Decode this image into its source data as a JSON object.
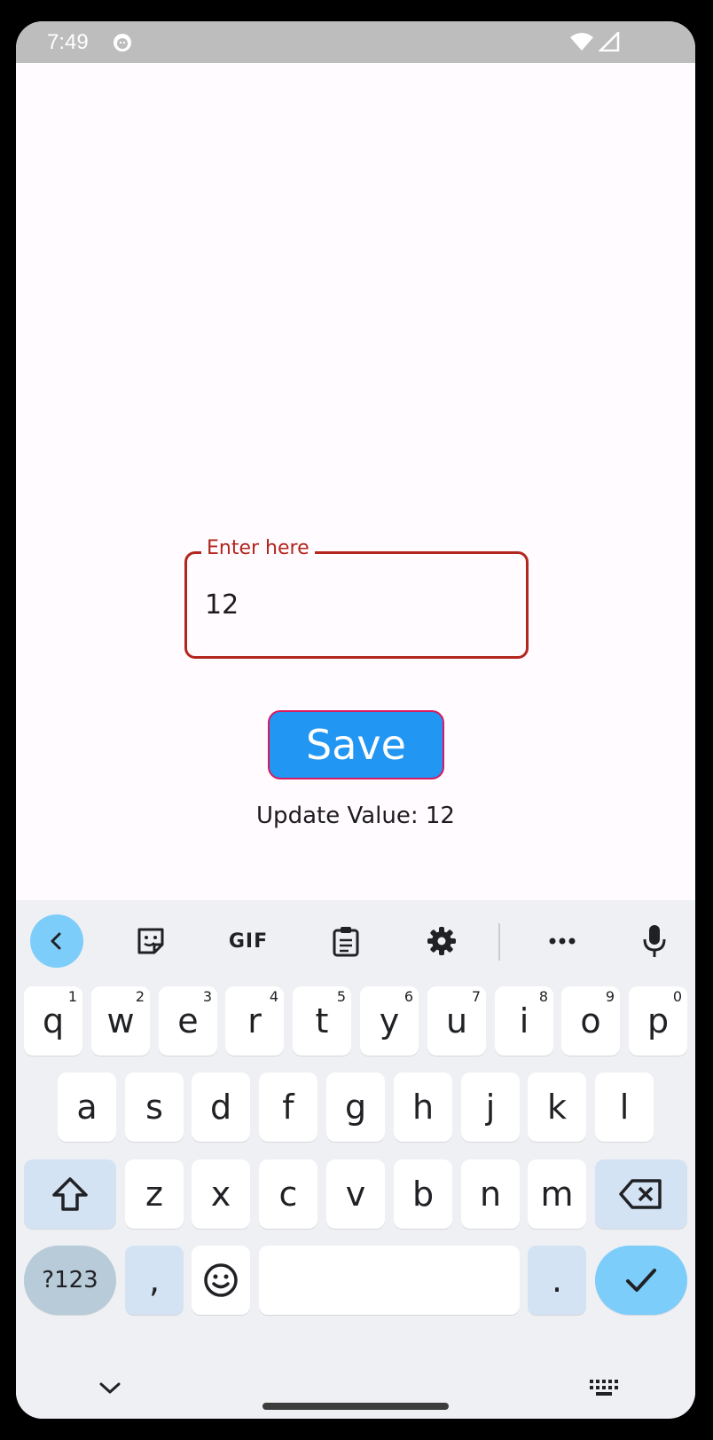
{
  "status_bar": {
    "time": "7:49"
  },
  "form": {
    "input_label": "Enter here",
    "input_value": "12",
    "save_label": "Save",
    "update_text": "Update Value: 12"
  },
  "keyboard": {
    "toolbar": {
      "gif_label": "GIF"
    },
    "row1": [
      {
        "key": "q",
        "num": "1"
      },
      {
        "key": "w",
        "num": "2"
      },
      {
        "key": "e",
        "num": "3"
      },
      {
        "key": "r",
        "num": "4"
      },
      {
        "key": "t",
        "num": "5"
      },
      {
        "key": "y",
        "num": "6"
      },
      {
        "key": "u",
        "num": "7"
      },
      {
        "key": "i",
        "num": "8"
      },
      {
        "key": "o",
        "num": "9"
      },
      {
        "key": "p",
        "num": "0"
      }
    ],
    "row2": [
      "a",
      "s",
      "d",
      "f",
      "g",
      "h",
      "j",
      "k",
      "l"
    ],
    "row3": [
      "z",
      "x",
      "c",
      "v",
      "b",
      "n",
      "m"
    ],
    "symbols_label": "?123",
    "comma_label": ",",
    "period_label": "."
  },
  "colors": {
    "accent_error": "#b3261e",
    "button_blue": "#2196f3",
    "button_border": "#d81b60",
    "keyboard_accent": "#7dcdfa"
  }
}
